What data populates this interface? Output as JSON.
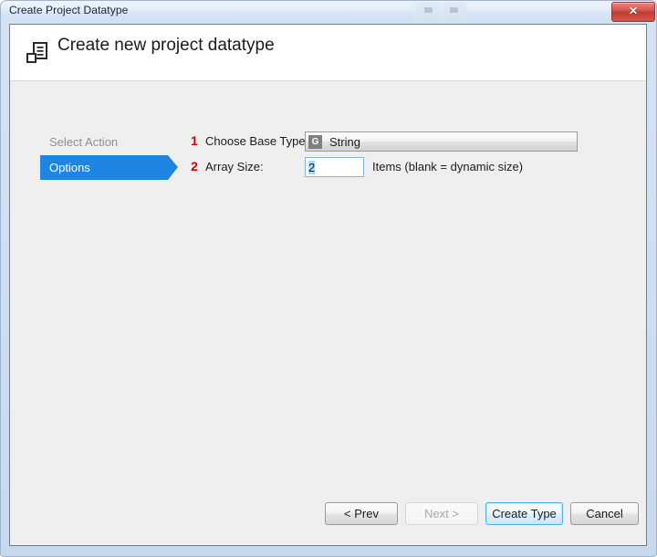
{
  "window": {
    "title": "Create Project Datatype",
    "controls": {
      "minimize_label": "",
      "maximize_label": "",
      "close_label": "✕"
    }
  },
  "header": {
    "icon": "datatype-structure-icon",
    "title": "Create new project datatype"
  },
  "sidebar": {
    "items": [
      {
        "label": "Select Action",
        "state": "inactive"
      },
      {
        "label": "Options",
        "state": "active"
      }
    ]
  },
  "form": {
    "rows": [
      {
        "step": "1",
        "label": "Choose Base Type:",
        "control": "dropdown",
        "badge": "G",
        "value": "String"
      },
      {
        "step": "2",
        "label": "Array Size:",
        "control": "textbox",
        "value": "2",
        "hint": "Items (blank = dynamic size)"
      }
    ]
  },
  "footer": {
    "buttons": [
      {
        "label": "< Prev",
        "state": "enabled"
      },
      {
        "label": "Next >",
        "state": "disabled"
      },
      {
        "label": "Create Type",
        "state": "default"
      },
      {
        "label": "Cancel",
        "state": "enabled"
      }
    ]
  },
  "colors": {
    "accent_blue": "#1E86E0",
    "step_number_red": "#CC0000",
    "default_button_border": "#4FB2E5",
    "close_button_red": "#C03C33",
    "body_background": "#EFEFEF"
  }
}
